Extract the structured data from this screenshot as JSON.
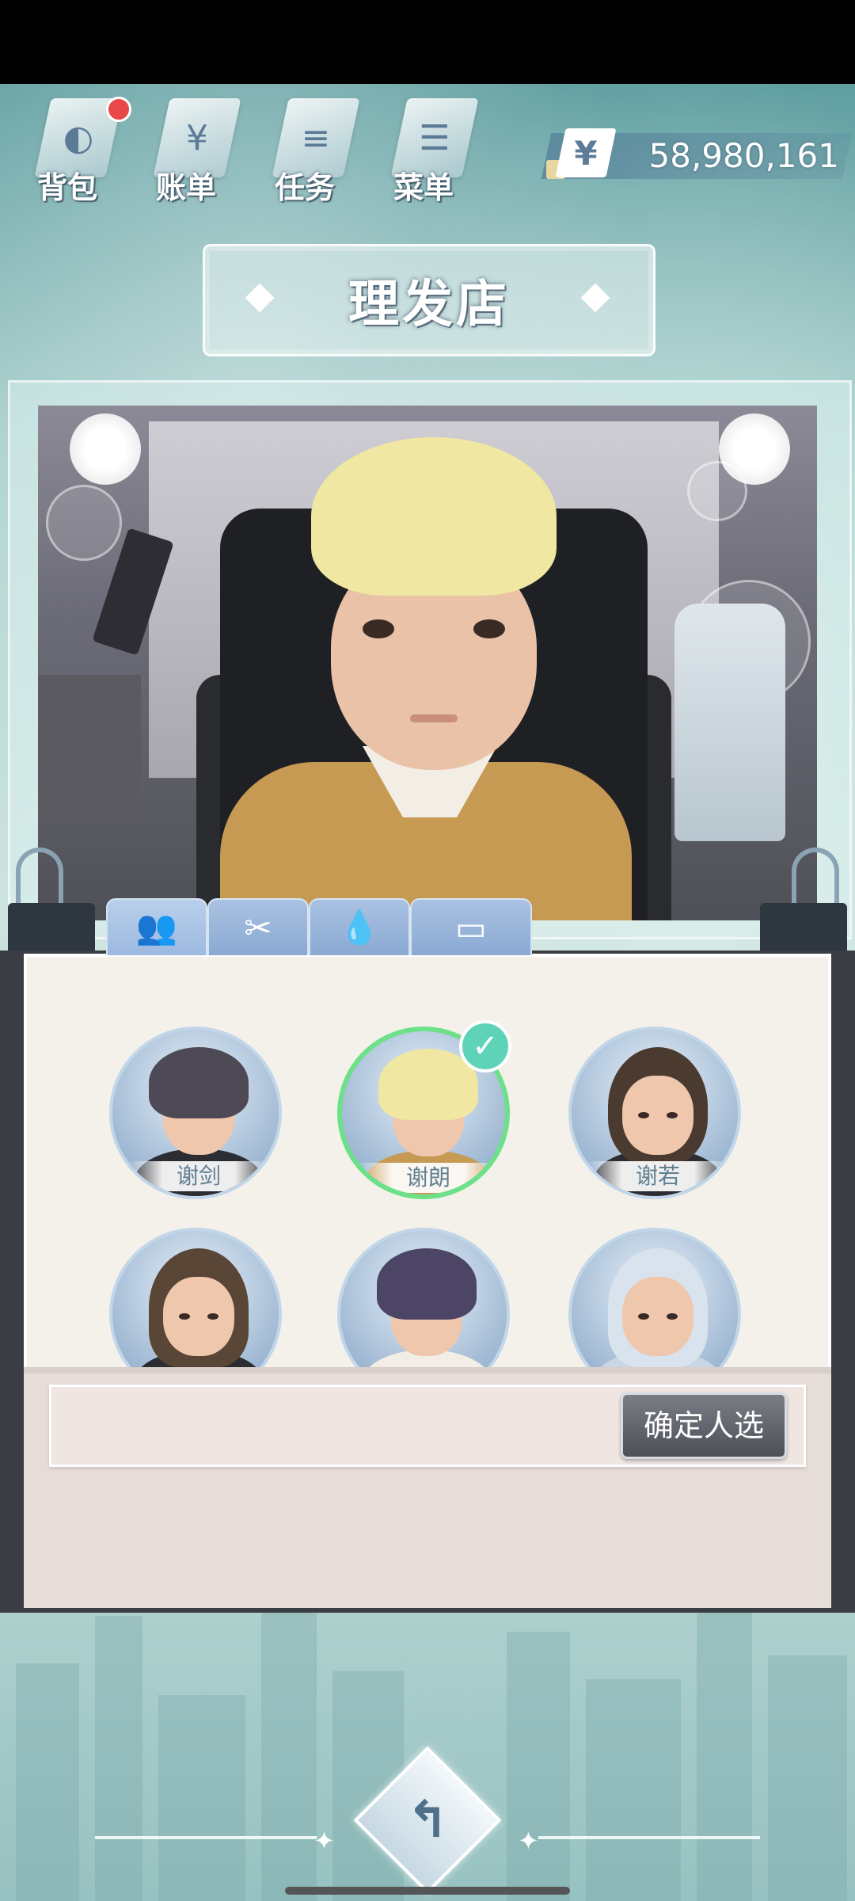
{
  "hud": {
    "buttons": [
      {
        "label": "背包",
        "icon": "backpack-icon",
        "has_notification": true
      },
      {
        "label": "账单",
        "icon": "bill-icon"
      },
      {
        "label": "任务",
        "icon": "task-icon"
      },
      {
        "label": "菜单",
        "icon": "menu-icon"
      }
    ],
    "currency_symbol": "¥",
    "money": "58,980,161"
  },
  "title": "理发店",
  "preview": {
    "character": "谢朗"
  },
  "tabs": [
    {
      "icon": "people-icon",
      "glyph": "👥",
      "active": true
    },
    {
      "icon": "scissors-icon",
      "glyph": "✂",
      "active": false
    },
    {
      "icon": "dye-icon",
      "glyph": "💧",
      "active": false
    },
    {
      "icon": "makeup-icon",
      "glyph": "▭",
      "active": false
    }
  ],
  "characters": [
    {
      "name": "谢剑",
      "selected": false
    },
    {
      "name": "谢朗",
      "selected": true
    },
    {
      "name": "谢若",
      "selected": false
    },
    {
      "name": "",
      "selected": false
    },
    {
      "name": "",
      "selected": false
    },
    {
      "name": "",
      "selected": false
    }
  ],
  "check_glyph": "✓",
  "confirm_label": "确定人选",
  "back_glyph": "↰",
  "colors": {
    "selected_ring": "#6de08a",
    "check_badge": "#5fd3b8",
    "tab": "#9db9df"
  }
}
